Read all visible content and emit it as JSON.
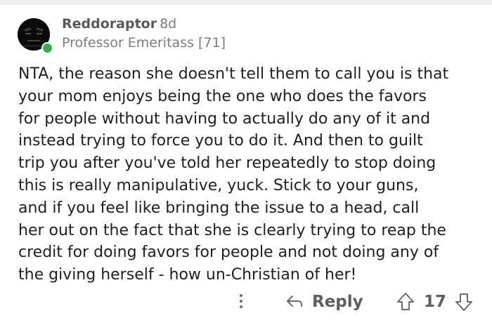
{
  "comment": {
    "author": "Reddoraptor",
    "age": "8d",
    "flair": "Professor Emeritass [71]",
    "body_lines": [
      "NTA, the reason she doesn't tell them to call you is that",
      "your mom enjoys being the one who does the favors",
      "for people without having to actually do any of it and",
      "instead trying to force you to do it.  And then to guilt",
      "trip you after you've told her repeatedly to stop doing",
      "this is really manipulative, yuck.  Stick to your guns,",
      "and if you feel like bringing the issue to a head, call",
      "her out on the fact that she is clearly trying to reap the",
      "credit for doing favors for people and not doing any of",
      "the giving herself - how un-Christian of her!"
    ],
    "online_status_color": "#2fb344"
  },
  "actions": {
    "more_icon": "vertical-dots-icon",
    "reply_icon": "reply-arrow-icon",
    "reply_label": "Reply",
    "upvote_icon": "upvote-arrow-icon",
    "score": "17",
    "downvote_icon": "downvote-arrow-icon"
  }
}
